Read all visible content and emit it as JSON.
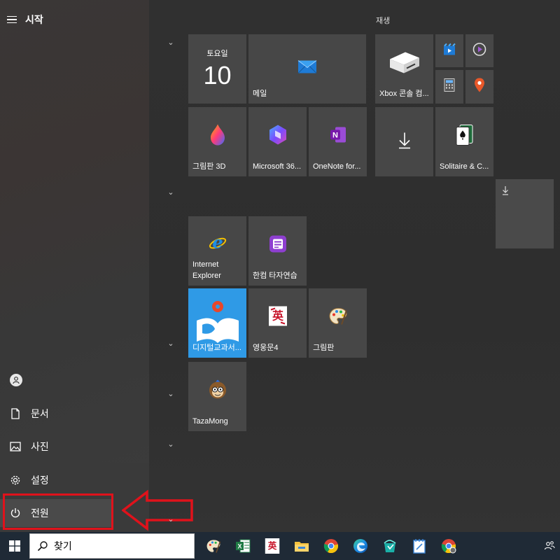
{
  "start_menu": {
    "title": "시작",
    "side_items": [
      {
        "label": "",
        "icon": "user-icon"
      },
      {
        "label": "문서",
        "icon": "document-icon"
      },
      {
        "label": "사진",
        "icon": "photo-icon"
      },
      {
        "label": "설정",
        "icon": "gear-icon"
      },
      {
        "label": "전원",
        "icon": "power-icon"
      }
    ]
  },
  "groups": {
    "play_label": "재생"
  },
  "tiles": {
    "calendar": {
      "day_name": "토요일",
      "day_number": "10"
    },
    "mail": {
      "label": "메일"
    },
    "xbox": {
      "label": "Xbox 콘솔 컴..."
    },
    "paint3d": {
      "label": "그림판 3D"
    },
    "m365": {
      "label": "Microsoft 36..."
    },
    "onenote": {
      "label": "OneNote for..."
    },
    "solitaire": {
      "label": "Solitaire & C..."
    },
    "ie": {
      "label": "Internet Explorer"
    },
    "hancom_typing": {
      "label": "한컴 타자연습"
    },
    "digital_textbook": {
      "label": "디지털교과서..."
    },
    "yeongung": {
      "label": "영웅문4"
    },
    "paint": {
      "label": "그림판"
    },
    "tazamong": {
      "label": "TazaMong"
    }
  },
  "taskbar": {
    "search_placeholder": "찾기",
    "apps": [
      "paint-icon",
      "excel-icon",
      "yeongung-icon",
      "file-explorer-icon",
      "chrome-icon",
      "edge-icon",
      "store-bag-icon",
      "notepad-icon",
      "chrome-dev-icon"
    ]
  },
  "colors": {
    "highlight_red": "#e0121b",
    "taskbar_bg": "#1f2a36",
    "tile_bg": "#474747"
  }
}
